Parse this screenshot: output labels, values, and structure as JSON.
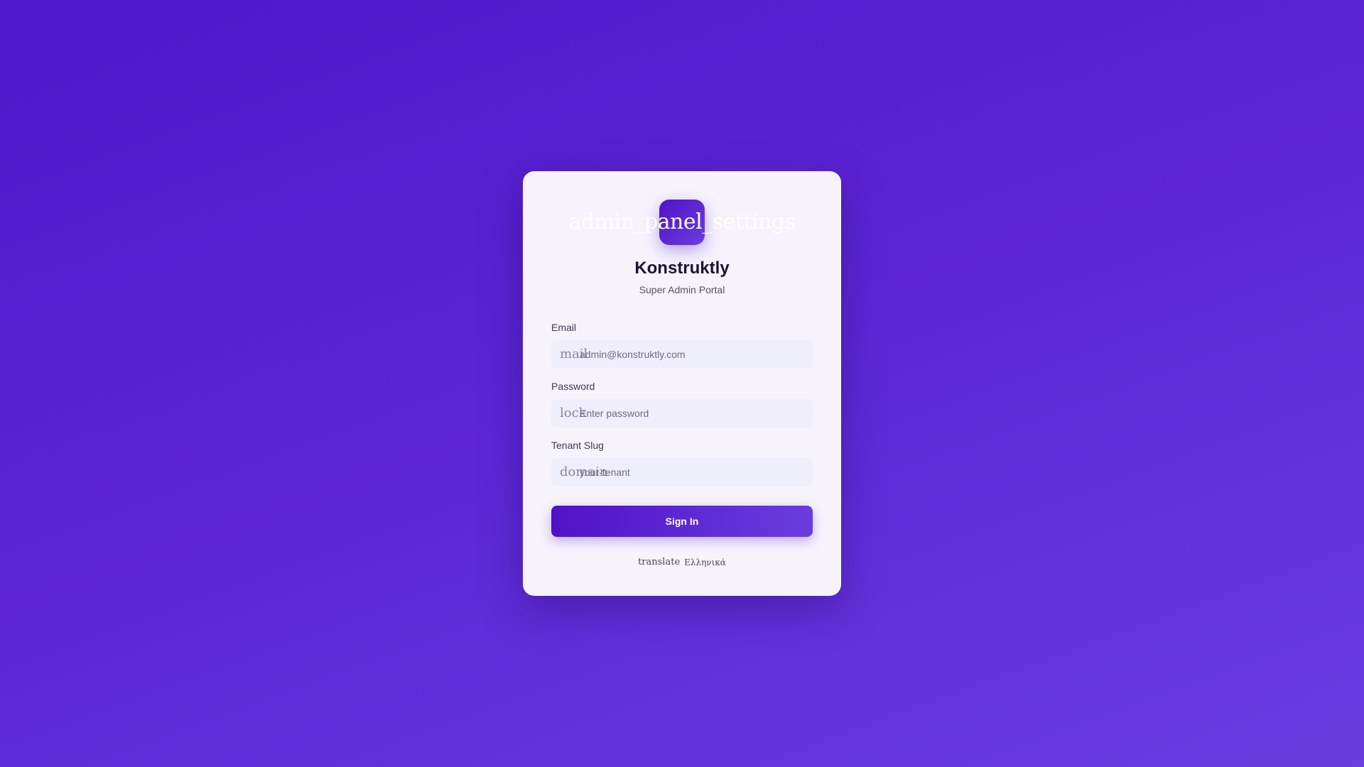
{
  "logo": {
    "icon_text": "admin_panel_settings"
  },
  "brand": {
    "name": "Konstruktly",
    "subtitle": "Super Admin Portal"
  },
  "form": {
    "email": {
      "label": "Email",
      "icon_text": "mail",
      "placeholder": "admin@konstruktly.com",
      "value": ""
    },
    "password": {
      "label": "Password",
      "icon_text": "lock",
      "placeholder": "Enter password",
      "value": ""
    },
    "tenant": {
      "label": "Tenant Slug",
      "icon_text": "domain",
      "placeholder": "your-tenant",
      "value": ""
    },
    "submit_label": "Sign In"
  },
  "language": {
    "icon_text": "translate",
    "label": "Ελληνικά"
  },
  "colors": {
    "background": "#5a22d3",
    "accent": "#5012c6",
    "card": "#f6f3fd"
  }
}
